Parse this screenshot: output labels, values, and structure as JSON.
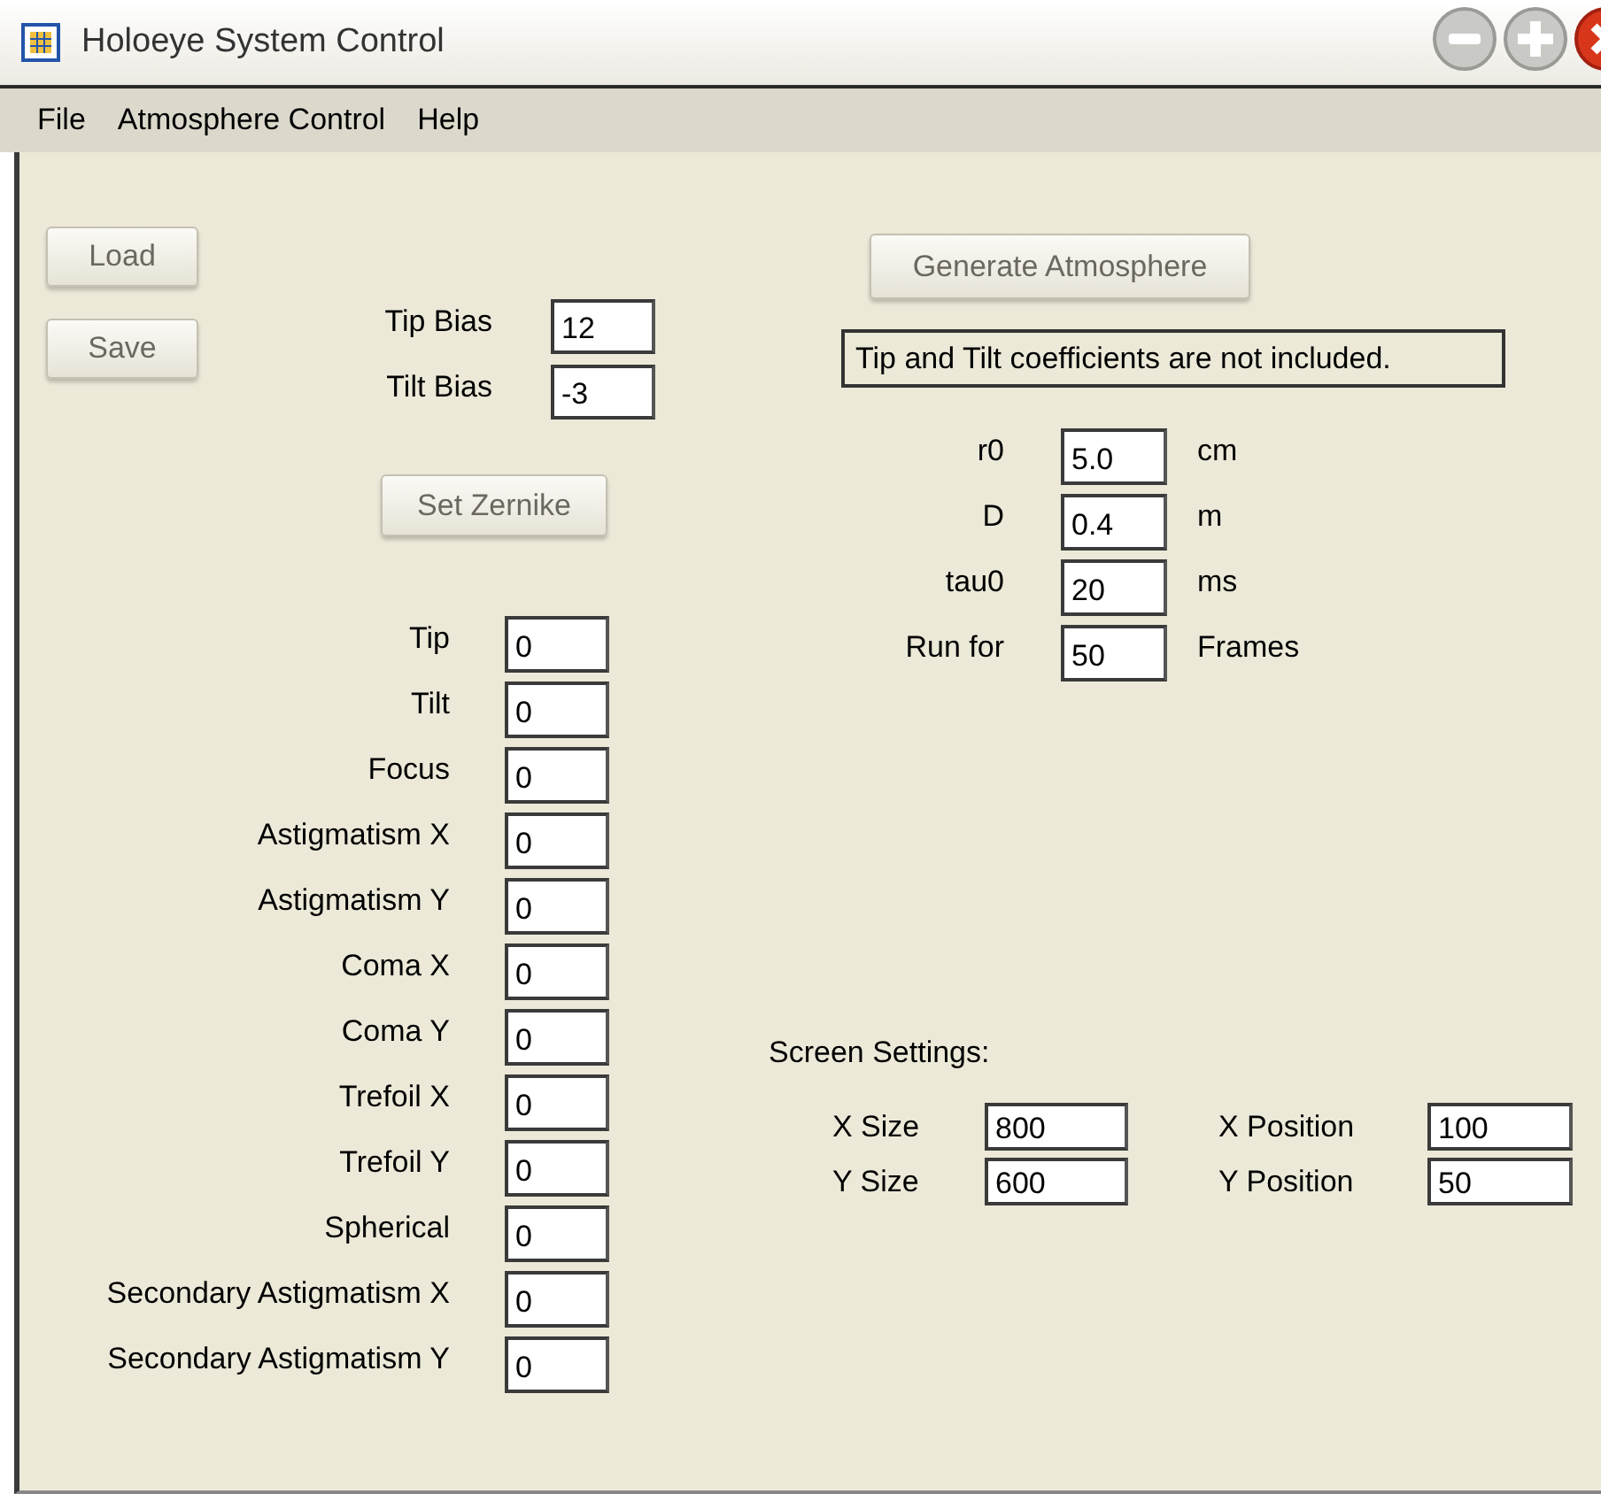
{
  "window": {
    "title": "Holoeye System Control"
  },
  "menu": [
    "File",
    "Atmosphere Control",
    "Help"
  ],
  "file_buttons": [
    "Load",
    "Save"
  ],
  "bias": [
    {
      "label": "Tip Bias",
      "value": "12"
    },
    {
      "label": "Tilt Bias",
      "value": "-3"
    }
  ],
  "set_zernike_button": "Set Zernike",
  "zernike": [
    {
      "label": "Tip",
      "value": "0"
    },
    {
      "label": "Tilt",
      "value": "0"
    },
    {
      "label": "Focus",
      "value": "0"
    },
    {
      "label": "Astigmatism X",
      "value": "0"
    },
    {
      "label": "Astigmatism Y",
      "value": "0"
    },
    {
      "label": "Coma X",
      "value": "0"
    },
    {
      "label": "Coma Y",
      "value": "0"
    },
    {
      "label": "Trefoil X",
      "value": "0"
    },
    {
      "label": "Trefoil Y",
      "value": "0"
    },
    {
      "label": "Spherical",
      "value": "0"
    },
    {
      "label": "Secondary Astigmatism X",
      "value": "0"
    },
    {
      "label": "Secondary Astigmatism Y",
      "value": "0"
    }
  ],
  "generate_button": "Generate Atmosphere",
  "notice": "Tip and Tilt coefficients are not included.",
  "atmosphere": [
    {
      "label": "r0",
      "value": "5.0",
      "unit": "cm"
    },
    {
      "label": "D",
      "value": "0.4",
      "unit": "m"
    },
    {
      "label": "tau0",
      "value": "20",
      "unit": "ms"
    },
    {
      "label": "Run for",
      "value": "50",
      "unit": "Frames"
    }
  ],
  "screen_settings": {
    "title": "Screen Settings:",
    "fields": [
      {
        "label": "X Size",
        "value": "800"
      },
      {
        "label": "X Position",
        "value": "100"
      },
      {
        "label": "Y Size",
        "value": "600"
      },
      {
        "label": "Y Position",
        "value": "50"
      }
    ]
  }
}
